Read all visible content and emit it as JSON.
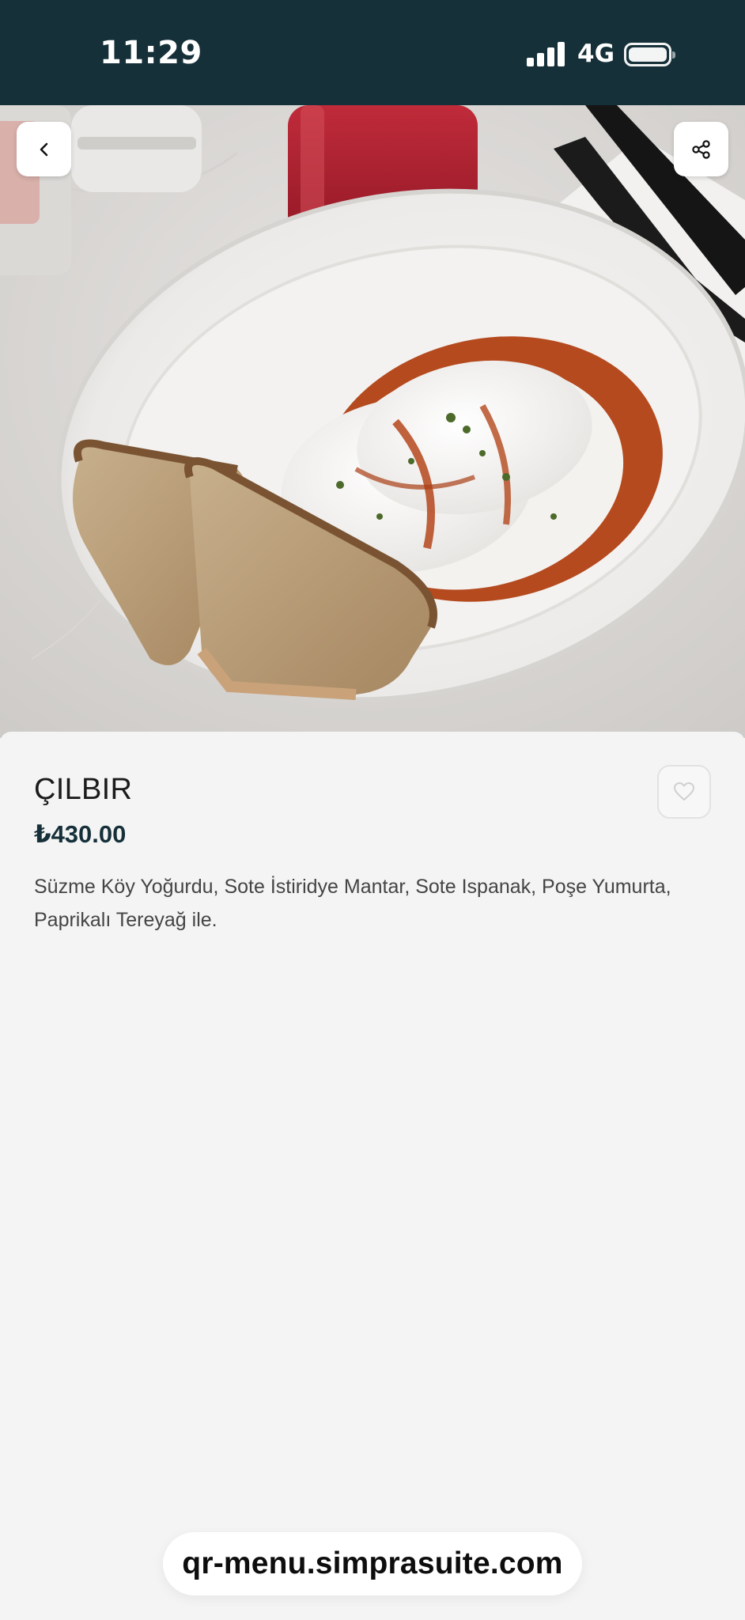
{
  "status_bar": {
    "time": "11:29",
    "network": "4G",
    "signal_icon": "signal-bars-icon",
    "battery_icon": "battery-icon"
  },
  "hero": {
    "image_icon": "food-photo",
    "back_icon": "chevron-left-icon",
    "share_icon": "share-icon"
  },
  "product": {
    "name": "ÇILBIR",
    "price": "₺430.00",
    "description": "Süzme Köy Yoğurdu, Sote İstiridye Mantar, Sote Ispanak, Poşe Yumurta, Paprikalı Tereyağ ile.",
    "favorite_icon": "heart-icon"
  },
  "browser": {
    "url": "qr-menu.simprasuite.com"
  },
  "colors": {
    "status_bar_bg": "#163039",
    "price": "#163039",
    "page_bg": "#f4f4f4"
  }
}
